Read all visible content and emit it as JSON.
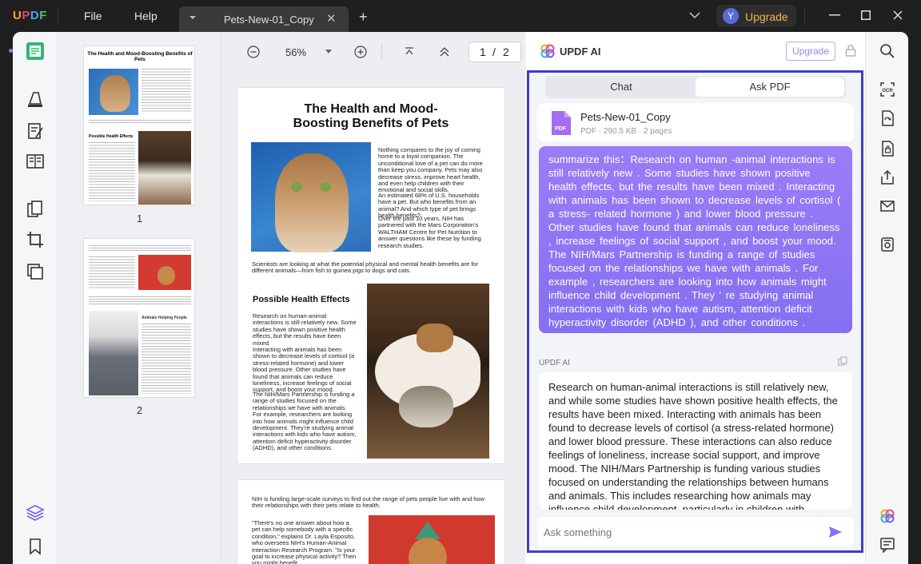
{
  "titlebar": {
    "logo": "UPDF",
    "menu_file": "File",
    "menu_help": "Help",
    "tab_name": "Pets-New-01_Copy",
    "new_tab": "+",
    "avatar_letter": "Y",
    "upgrade": "Upgrade"
  },
  "viewer": {
    "zoom": "56%",
    "page_current": "1",
    "page_sep": "/",
    "page_total": "2"
  },
  "thumbnails": [
    {
      "page_label": "1"
    },
    {
      "page_label": "2"
    }
  ],
  "document": {
    "title": "The Health and Mood-Boosting Benefits of Pets",
    "intro": "Nothing compares to the joy of coming home to a loyal companion. The unconditional love of a pet can do more than keep you company. Pets may also decrease stress, improve heart health, and even help children with their emotional and social skills.",
    "households": "An estimated 68% of U.S. households have a pet. But who benefits from an animal? And which type of pet brings health benefits?",
    "nih_years": "Over the past 10 years, NIH has partnered with the Mars Corporation's WALTHAM Centre for Pet Nutrition to answer questions like these by funding research studies.",
    "scientists": "Scientists are looking at what the potential physical and mental health benefits are for different animals—from fish to guinea pigs to dogs and cats.",
    "section_title": "Possible Health Effects",
    "effects_1": "Research on human-animal interactions is still relatively new. Some studies have shown positive health effects, but the results have been mixed.",
    "effects_2": "Interacting with animals has been shown to decrease levels of cortisol (a stress-related hormone) and lower blood pressure. Other studies have found that animals can reduce loneliness, increase feelings of social support, and boost your mood.",
    "effects_3": "The NIH/Mars Partnership is funding a range of studies focused on the relationships we have with animals. For example, researchers are looking into how animals might influence child development. They're studying animal interactions with kids who have autism, attention deficit hyperactivity disorder (ADHD), and other conditions.",
    "page2_intro": "NIH is funding large-scale surveys to find out the range of pets people live with and how their relationships with their pets relate to health.",
    "page2_quote": "\"There's no one answer about how a pet can help somebody with a specific condition,\" explains Dr. Layla Esposito, who oversees NIH's Human-Animal Interaction Research Program. \"Is your goal to increase physical activity? Then you might benefit"
  },
  "ai_panel": {
    "title": "UPDF AI",
    "upgrade": "Upgrade",
    "tab_chat": "Chat",
    "tab_ask_pdf": "Ask PDF",
    "file_name": "Pets-New-01_Copy",
    "file_meta": "PDF · 290.5 KB · 2 pages",
    "pdf_badge": "PDF",
    "user_message": "summarize this：Research on human -animal interactions is still relatively new . Some studies have shown positive health effects, but the results have been mixed . Interacting with animals has been shown to decrease levels of cortisol ( a stress- related hormone ) and lower blood pressure . Other studies have found that animals can reduce loneliness , increase feelings  of social support , and boost your mood. The NIH/Mars Partnership is funding a range of studies focused on the relationships we have with animals . For example , researchers are looking into how animals might influence child development . They ' re studying animal interactions with kids who have autism, attention deficit hyperactivity disorder (ADHD ), and other conditions .",
    "response_label": "UPDF AI",
    "response": "Research on human-animal interactions is still relatively new, and while some studies have shown positive health effects, the results have been mixed. Interacting with animals has been found to decrease levels of cortisol (a stress-related hormone) and lower blood pressure. These interactions can also reduce feelings of loneliness, increase social support, and improve mood. The NIH/Mars Partnership is funding various studies focused on understanding the relationships between humans and animals. This includes researching how animals may influence child development, particularly in children with",
    "ask_placeholder": "Ask something"
  },
  "colors": {
    "accent_purple": "#8470f2",
    "frame_blue": "#3d3ec8",
    "upgrade_gold": "#f3b64a"
  }
}
